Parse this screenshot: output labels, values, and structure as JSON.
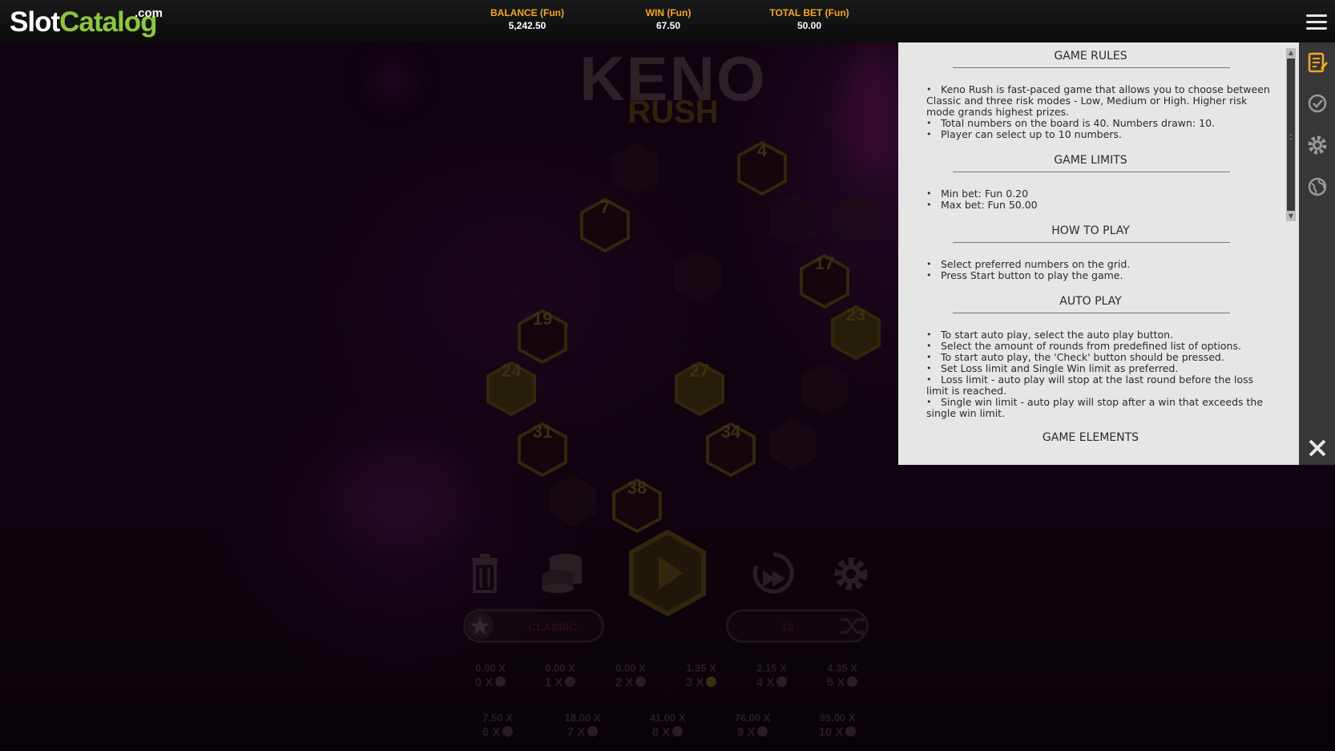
{
  "logo": {
    "slot": "Slot",
    "catalog": "Catalog",
    "dotcom": ".com"
  },
  "stats": {
    "balance_label": "BALANCE (Fun)",
    "balance_value": "5,242.50",
    "win_label": "WIN (Fun)",
    "win_value": "67.50",
    "total_bet_label": "TOTAL BET (Fun)",
    "total_bet_value": "50.00"
  },
  "game": {
    "title_line1": "KENO",
    "title_line2": "RUSH",
    "hexes": [
      {
        "label": "",
        "lit": false
      },
      {
        "label": "4",
        "lit": true
      },
      {
        "label": "7",
        "lit": true
      },
      {
        "label": "",
        "lit": false
      },
      {
        "label": "",
        "lit": false
      },
      {
        "label": "",
        "lit": false
      },
      {
        "label": "17",
        "lit": true
      },
      {
        "label": "19",
        "lit": true
      },
      {
        "label": "23",
        "lit": true
      },
      {
        "label": "24",
        "lit": true
      },
      {
        "label": "27",
        "lit": true
      },
      {
        "label": "",
        "lit": false
      },
      {
        "label": "31",
        "lit": true
      },
      {
        "label": "34",
        "lit": true
      },
      {
        "label": "",
        "lit": false
      },
      {
        "label": "",
        "lit": false
      },
      {
        "label": "38",
        "lit": true
      }
    ],
    "mode_label": "CLASSIC",
    "count_label": "10",
    "paytable_row1": [
      {
        "mult": "0.00 X",
        "hits": "0 X",
        "gold": false
      },
      {
        "mult": "0.00 X",
        "hits": "1 X",
        "gold": false
      },
      {
        "mult": "0.00 X",
        "hits": "2 X",
        "gold": false
      },
      {
        "mult": "1.35 X",
        "hits": "3 X",
        "gold": true
      },
      {
        "mult": "2.15 X",
        "hits": "4 X",
        "gold": false
      },
      {
        "mult": "4.35 X",
        "hits": "5 X",
        "gold": false
      }
    ],
    "paytable_row2": [
      {
        "mult": "7.50 X",
        "hits": "6 X"
      },
      {
        "mult": "18.00 X",
        "hits": "7 X"
      },
      {
        "mult": "41.00 X",
        "hits": "8 X"
      },
      {
        "mult": "76.00 X",
        "hits": "9 X"
      },
      {
        "mult": "95.00 X",
        "hits": "10 X"
      }
    ]
  },
  "rules": {
    "game_rules_title": "GAME RULES",
    "game_rules": [
      "Keno Rush is fast-paced game that allows you to choose between Classic and three risk modes - Low, Medium or High. Higher risk mode grands highest prizes.",
      "Total numbers on the board is 40. Numbers drawn: 10.",
      "Player can select up to 10 numbers."
    ],
    "game_limits_title": "GAME LIMITS",
    "game_limits": [
      "Min bet: Fun 0.20",
      "Max bet: Fun 50.00"
    ],
    "how_to_play_title": "HOW TO PLAY",
    "how_to_play": [
      "Select preferred numbers on the grid.",
      "Press Start button to play the game."
    ],
    "auto_play_title": "AUTO PLAY",
    "auto_play": [
      "To start auto play, select the auto play button.",
      "Select the amount of rounds from predefined list of options.",
      "To start auto play, the 'Check' button should be pressed.",
      "Set Loss limit and Single Win limit as preferred.",
      "Loss limit - auto play will stop at the last round before the loss limit is reached.",
      "Single win limit - auto play will stop after a win that exceeds the single win limit."
    ],
    "game_elements_title": "GAME ELEMENTS"
  },
  "side_icons": [
    "rules-icon",
    "history-icon",
    "settings-icon",
    "language-icon"
  ],
  "colors": {
    "accent": "#f5a623",
    "brand_green": "#8cc63f",
    "panel_bg": "#e6e6e6",
    "side_col": "#3c3c3c"
  }
}
